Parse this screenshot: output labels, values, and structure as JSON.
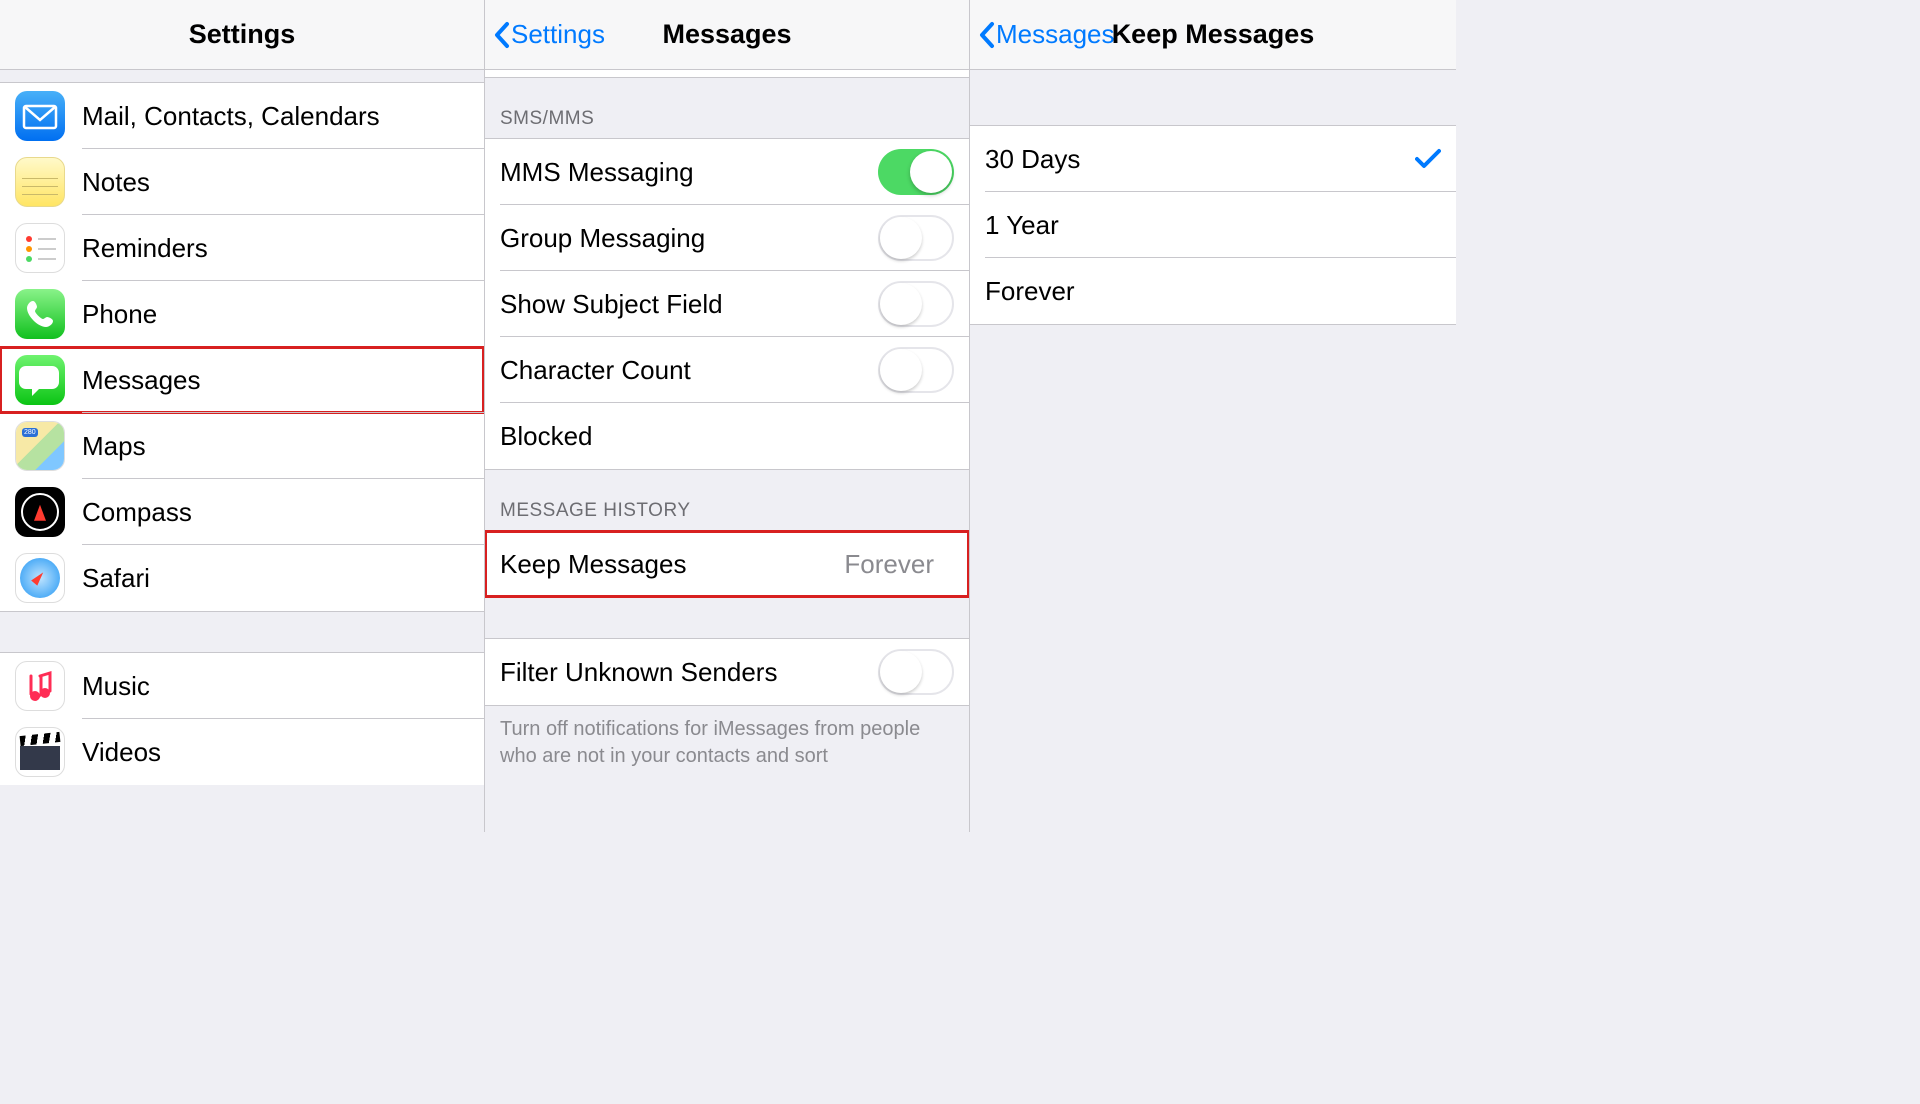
{
  "panel1": {
    "title": "Settings",
    "groups": [
      {
        "items": [
          {
            "id": "mail",
            "label": "Mail, Contacts, Calendars",
            "icon": "mail-icon"
          },
          {
            "id": "notes",
            "label": "Notes",
            "icon": "notes-icon"
          },
          {
            "id": "remind",
            "label": "Reminders",
            "icon": "reminders-icon"
          },
          {
            "id": "phone",
            "label": "Phone",
            "icon": "phone-icon"
          },
          {
            "id": "messages",
            "label": "Messages",
            "icon": "messages-icon",
            "highlight": true
          },
          {
            "id": "maps",
            "label": "Maps",
            "icon": "maps-icon"
          },
          {
            "id": "compass",
            "label": "Compass",
            "icon": "compass-icon"
          },
          {
            "id": "safari",
            "label": "Safari",
            "icon": "safari-icon"
          }
        ]
      },
      {
        "items": [
          {
            "id": "music",
            "label": "Music",
            "icon": "music-icon"
          },
          {
            "id": "videos",
            "label": "Videos",
            "icon": "videos-icon"
          }
        ]
      }
    ]
  },
  "panel2": {
    "back": "Settings",
    "title": "Messages",
    "sections": {
      "sms_header": "SMS/MMS",
      "sms_items": [
        {
          "label": "MMS Messaging",
          "type": "switch",
          "on": true
        },
        {
          "label": "Group Messaging",
          "type": "switch",
          "on": false
        },
        {
          "label": "Show Subject Field",
          "type": "switch",
          "on": false
        },
        {
          "label": "Character Count",
          "type": "switch",
          "on": false
        },
        {
          "label": "Blocked",
          "type": "link"
        }
      ],
      "history_header": "MESSAGE HISTORY",
      "keep_label": "Keep Messages",
      "keep_value": "Forever",
      "filter_label": "Filter Unknown Senders",
      "filter_on": false,
      "filter_footer": "Turn off notifications for iMessages from people who are not in your contacts and sort"
    }
  },
  "panel3": {
    "back": "Messages",
    "title": "Keep Messages",
    "options": [
      {
        "label": "30 Days",
        "selected": true
      },
      {
        "label": "1 Year",
        "selected": false
      },
      {
        "label": "Forever",
        "selected": false
      }
    ]
  }
}
